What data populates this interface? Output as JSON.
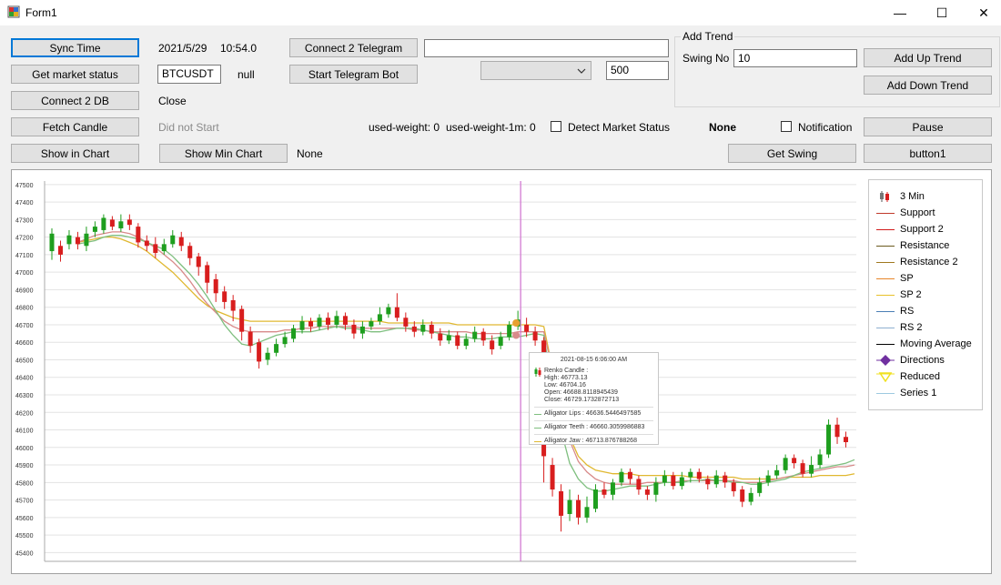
{
  "window": {
    "title": "Form1",
    "minimize": "—",
    "maximize": "☐",
    "close": "✕"
  },
  "left_buttons": {
    "sync_time": "Sync Time",
    "get_market_status": "Get market status",
    "connect_db": "Connect 2 DB",
    "fetch_candle": "Fetch Candle",
    "show_in_chart": "Show in Chart"
  },
  "info": {
    "date": "2021/5/29",
    "time": "10:54.0",
    "symbol": "BTCUSDT",
    "null_label": "null",
    "close_label": "Close",
    "did_not_start": "Did not Start",
    "show_min_chart": "Show Min Chart",
    "none_label": "None"
  },
  "telegram": {
    "connect": "Connect 2 Telegram",
    "start_bot": "Start Telegram Bot",
    "text_value": "",
    "combo_value": "",
    "number_value": "500"
  },
  "weights": {
    "used_weight": "used-weight: 0",
    "used_weight_1m": "used-weight-1m: 0"
  },
  "detect": {
    "label": "Detect Market Status",
    "status": "None",
    "notification": "Notification"
  },
  "trend": {
    "group_title": "Add Trend",
    "swing_label": "Swing No",
    "swing_value": "10",
    "add_up": "Add Up Trend",
    "add_down": "Add Down Trend"
  },
  "right_buttons": {
    "pause": "Pause",
    "get_swing": "Get Swing",
    "button1": "button1"
  },
  "tooltip": {
    "date": "2021-08-15 6:06:00 AM",
    "candle_title": "Renko Candle :",
    "high": "High: 46773.13",
    "low": "Low: 46704.16",
    "open": "Open: 46688.8118945439",
    "close": "Close: 46729.1732872713",
    "lips": "Alligator Lips : 46636.5446497585",
    "teeth": "Alligator Teeth : 46660.3059986883",
    "jaw": "Alligator Jaw : 46713.876788268"
  },
  "legend": [
    {
      "label": "3 Min",
      "type": "candle",
      "color": "#d81e1e"
    },
    {
      "label": "Support",
      "type": "line",
      "color": "#c0392b"
    },
    {
      "label": "Support 2",
      "type": "line",
      "color": "#d11a1a"
    },
    {
      "label": "Resistance",
      "type": "line",
      "color": "#6b5a1e"
    },
    {
      "label": "Resistance 2",
      "type": "line",
      "color": "#a0781e"
    },
    {
      "label": "SP",
      "type": "line",
      "color": "#e8862a"
    },
    {
      "label": "SP 2",
      "type": "line",
      "color": "#e8c02a"
    },
    {
      "label": "RS",
      "type": "line",
      "color": "#4a7fb5"
    },
    {
      "label": "RS 2",
      "type": "line",
      "color": "#8fb0d0"
    },
    {
      "label": "Moving Average",
      "type": "line",
      "color": "#000000"
    },
    {
      "label": "Directions",
      "type": "diamond",
      "color": "#7030a0"
    },
    {
      "label": "Reduced",
      "type": "triangle",
      "color": "#f0e020"
    },
    {
      "label": "Series 1",
      "type": "line",
      "color": "#9ec9e0"
    }
  ],
  "chart_data": {
    "type": "candlestick",
    "ylim": [
      45350,
      47520
    ],
    "y_ticks": [
      47500,
      47400,
      47300,
      47200,
      47100,
      47000,
      46900,
      46800,
      46700,
      46600,
      46500,
      46400,
      46300,
      46200,
      46100,
      46000,
      45900,
      45800,
      45700,
      45600,
      45500,
      45400
    ],
    "colors": {
      "up": "#1e9e1e",
      "down": "#d81e1e",
      "lips": "#7fbf7f",
      "teeth": "#d88a8a",
      "jaw": "#e0b830",
      "cursor": "#d070d0"
    },
    "candles": [
      {
        "o": 47120,
        "c": 47220,
        "h": 47250,
        "l": 47070
      },
      {
        "o": 47150,
        "c": 47100,
        "h": 47180,
        "l": 47060
      },
      {
        "o": 47160,
        "c": 47210,
        "h": 47240,
        "l": 47130
      },
      {
        "o": 47200,
        "c": 47160,
        "h": 47230,
        "l": 47130
      },
      {
        "o": 47150,
        "c": 47220,
        "h": 47260,
        "l": 47120
      },
      {
        "o": 47230,
        "c": 47260,
        "h": 47290,
        "l": 47200
      },
      {
        "o": 47240,
        "c": 47310,
        "h": 47330,
        "l": 47220
      },
      {
        "o": 47300,
        "c": 47260,
        "h": 47320,
        "l": 47240
      },
      {
        "o": 47250,
        "c": 47290,
        "h": 47330,
        "l": 47230
      },
      {
        "o": 47300,
        "c": 47270,
        "h": 47330,
        "l": 47240
      },
      {
        "o": 47260,
        "c": 47170,
        "h": 47280,
        "l": 47140
      },
      {
        "o": 47180,
        "c": 47150,
        "h": 47210,
        "l": 47120
      },
      {
        "o": 47160,
        "c": 47110,
        "h": 47200,
        "l": 47080
      },
      {
        "o": 47120,
        "c": 47160,
        "h": 47190,
        "l": 47100
      },
      {
        "o": 47160,
        "c": 47210,
        "h": 47240,
        "l": 47140
      },
      {
        "o": 47200,
        "c": 47150,
        "h": 47230,
        "l": 47120
      },
      {
        "o": 47150,
        "c": 47080,
        "h": 47170,
        "l": 47040
      },
      {
        "o": 47090,
        "c": 47030,
        "h": 47110,
        "l": 46980
      },
      {
        "o": 47040,
        "c": 46940,
        "h": 47060,
        "l": 46880
      },
      {
        "o": 46960,
        "c": 46880,
        "h": 46990,
        "l": 46830
      },
      {
        "o": 46890,
        "c": 46830,
        "h": 46920,
        "l": 46790
      },
      {
        "o": 46840,
        "c": 46780,
        "h": 46870,
        "l": 46720
      },
      {
        "o": 46790,
        "c": 46660,
        "h": 46810,
        "l": 46610
      },
      {
        "o": 46660,
        "c": 46580,
        "h": 46690,
        "l": 46540
      },
      {
        "o": 46600,
        "c": 46490,
        "h": 46620,
        "l": 46450
      },
      {
        "o": 46500,
        "c": 46540,
        "h": 46570,
        "l": 46470
      },
      {
        "o": 46540,
        "c": 46590,
        "h": 46620,
        "l": 46520
      },
      {
        "o": 46590,
        "c": 46630,
        "h": 46660,
        "l": 46570
      },
      {
        "o": 46620,
        "c": 46680,
        "h": 46700,
        "l": 46600
      },
      {
        "o": 46670,
        "c": 46720,
        "h": 46750,
        "l": 46650
      },
      {
        "o": 46720,
        "c": 46690,
        "h": 46740,
        "l": 46660
      },
      {
        "o": 46690,
        "c": 46740,
        "h": 46760,
        "l": 46670
      },
      {
        "o": 46740,
        "c": 46700,
        "h": 46770,
        "l": 46670
      },
      {
        "o": 46700,
        "c": 46750,
        "h": 46780,
        "l": 46680
      },
      {
        "o": 46750,
        "c": 46700,
        "h": 46770,
        "l": 46670
      },
      {
        "o": 46700,
        "c": 46650,
        "h": 46730,
        "l": 46620
      },
      {
        "o": 46650,
        "c": 46690,
        "h": 46720,
        "l": 46620
      },
      {
        "o": 46690,
        "c": 46720,
        "h": 46740,
        "l": 46670
      },
      {
        "o": 46720,
        "c": 46760,
        "h": 46800,
        "l": 46700
      },
      {
        "o": 46760,
        "c": 46800,
        "h": 46820,
        "l": 46740
      },
      {
        "o": 46800,
        "c": 46740,
        "h": 46880,
        "l": 46720
      },
      {
        "o": 46740,
        "c": 46690,
        "h": 46770,
        "l": 46660
      },
      {
        "o": 46690,
        "c": 46660,
        "h": 46720,
        "l": 46630
      },
      {
        "o": 46660,
        "c": 46700,
        "h": 46730,
        "l": 46640
      },
      {
        "o": 46700,
        "c": 46650,
        "h": 46720,
        "l": 46620
      },
      {
        "o": 46650,
        "c": 46610,
        "h": 46680,
        "l": 46580
      },
      {
        "o": 46610,
        "c": 46640,
        "h": 46670,
        "l": 46590
      },
      {
        "o": 46640,
        "c": 46580,
        "h": 46660,
        "l": 46560
      },
      {
        "o": 46580,
        "c": 46620,
        "h": 46650,
        "l": 46560
      },
      {
        "o": 46620,
        "c": 46660,
        "h": 46690,
        "l": 46600
      },
      {
        "o": 46660,
        "c": 46610,
        "h": 46680,
        "l": 46580
      },
      {
        "o": 46610,
        "c": 46560,
        "h": 46640,
        "l": 46530
      },
      {
        "o": 46580,
        "c": 46630,
        "h": 46660,
        "l": 46560
      },
      {
        "o": 46630,
        "c": 46700,
        "h": 46720,
        "l": 46610
      },
      {
        "o": 46690,
        "c": 46730,
        "h": 46780,
        "l": 46670
      },
      {
        "o": 46700,
        "c": 46660,
        "h": 46740,
        "l": 46630
      },
      {
        "o": 46660,
        "c": 46610,
        "h": 46690,
        "l": 46580
      },
      {
        "o": 46610,
        "c": 45950,
        "h": 46630,
        "l": 45800
      },
      {
        "o": 45900,
        "c": 45760,
        "h": 45940,
        "l": 45720
      },
      {
        "o": 45750,
        "c": 45610,
        "h": 45790,
        "l": 45520
      },
      {
        "o": 45620,
        "c": 45700,
        "h": 45760,
        "l": 45580
      },
      {
        "o": 45700,
        "c": 45600,
        "h": 45730,
        "l": 45560
      },
      {
        "o": 45600,
        "c": 45660,
        "h": 45720,
        "l": 45570
      },
      {
        "o": 45650,
        "c": 45760,
        "h": 45790,
        "l": 45630
      },
      {
        "o": 45760,
        "c": 45730,
        "h": 45800,
        "l": 45710
      },
      {
        "o": 45730,
        "c": 45800,
        "h": 45820,
        "l": 45700
      },
      {
        "o": 45800,
        "c": 45860,
        "h": 45880,
        "l": 45780
      },
      {
        "o": 45860,
        "c": 45820,
        "h": 45880,
        "l": 45790
      },
      {
        "o": 45820,
        "c": 45760,
        "h": 45840,
        "l": 45730
      },
      {
        "o": 45760,
        "c": 45730,
        "h": 45780,
        "l": 45700
      },
      {
        "o": 45730,
        "c": 45800,
        "h": 45830,
        "l": 45690
      },
      {
        "o": 45800,
        "c": 45840,
        "h": 45870,
        "l": 45780
      },
      {
        "o": 45840,
        "c": 45780,
        "h": 45860,
        "l": 45760
      },
      {
        "o": 45780,
        "c": 45830,
        "h": 45860,
        "l": 45760
      },
      {
        "o": 45830,
        "c": 45860,
        "h": 45880,
        "l": 45800
      },
      {
        "o": 45860,
        "c": 45820,
        "h": 45880,
        "l": 45800
      },
      {
        "o": 45820,
        "c": 45790,
        "h": 45840,
        "l": 45760
      },
      {
        "o": 45790,
        "c": 45840,
        "h": 45870,
        "l": 45770
      },
      {
        "o": 45840,
        "c": 45800,
        "h": 45860,
        "l": 45770
      },
      {
        "o": 45800,
        "c": 45750,
        "h": 45820,
        "l": 45720
      },
      {
        "o": 45760,
        "c": 45690,
        "h": 45780,
        "l": 45660
      },
      {
        "o": 45690,
        "c": 45740,
        "h": 45770,
        "l": 45670
      },
      {
        "o": 45740,
        "c": 45800,
        "h": 45830,
        "l": 45720
      },
      {
        "o": 45800,
        "c": 45840,
        "h": 45870,
        "l": 45780
      },
      {
        "o": 45840,
        "c": 45870,
        "h": 45900,
        "l": 45820
      },
      {
        "o": 45870,
        "c": 45940,
        "h": 45960,
        "l": 45850
      },
      {
        "o": 45940,
        "c": 45910,
        "h": 45960,
        "l": 45880
      },
      {
        "o": 45910,
        "c": 45850,
        "h": 45930,
        "l": 45830
      },
      {
        "o": 45850,
        "c": 45900,
        "h": 45950,
        "l": 45830
      },
      {
        "o": 45900,
        "c": 45960,
        "h": 45990,
        "l": 45880
      },
      {
        "o": 45960,
        "c": 46130,
        "h": 46160,
        "l": 45940
      },
      {
        "o": 46130,
        "c": 46060,
        "h": 46170,
        "l": 46020
      },
      {
        "o": 46060,
        "c": 46030,
        "h": 46090,
        "l": 46000
      }
    ],
    "lips": [
      47160,
      47170,
      47180,
      47200,
      47210,
      47210,
      47200,
      47190,
      47170,
      47150,
      47130,
      47090,
      47040,
      46990,
      46930,
      46860,
      46780,
      46700,
      46640,
      46590,
      46580,
      46600,
      46620,
      46640,
      46650,
      46660,
      46660,
      46660,
      46670,
      46680,
      46690,
      46680,
      46680,
      46670,
      46660,
      46660,
      46670,
      46680,
      46680,
      46680,
      46670,
      46660,
      46650,
      46640,
      46630,
      46630,
      46620,
      46620,
      46620,
      46630,
      46630,
      46630,
      46640,
      46650,
      46640,
      46330,
      46100,
      45910,
      45820,
      45770,
      45750,
      45750,
      45760,
      45770,
      45780,
      45780,
      45780,
      45790,
      45800,
      45800,
      45800,
      45810,
      45810,
      45820,
      45810,
      45810,
      45800,
      45800,
      45790,
      45790,
      45800,
      45810,
      45820,
      45840,
      45860,
      45870,
      45880,
      45890,
      45900,
      45910,
      45930
    ],
    "teeth": [
      47170,
      47190,
      47210,
      47220,
      47230,
      47230,
      47220,
      47200,
      47170,
      47140,
      47100,
      47060,
      47010,
      46950,
      46880,
      46820,
      46770,
      46720,
      46690,
      46670,
      46660,
      46660,
      46660,
      46660,
      46670,
      46670,
      46680,
      46680,
      46690,
      46690,
      46690,
      46690,
      46690,
      46680,
      46680,
      46680,
      46680,
      46680,
      46680,
      46670,
      46670,
      46660,
      46660,
      46660,
      46660,
      46660,
      46650,
      46650,
      46650,
      46650,
      46650,
      46660,
      46660,
      46660,
      46660,
      46440,
      46230,
      46040,
      45920,
      45860,
      45820,
      45800,
      45790,
      45790,
      45790,
      45790,
      45800,
      45800,
      45800,
      45800,
      45810,
      45810,
      45810,
      45810,
      45810,
      45810,
      45810,
      45800,
      45800,
      45800,
      45810,
      45820,
      45830,
      45840,
      45850,
      45860,
      45870,
      45880,
      45890,
      45890,
      45900
    ],
    "jaw": [
      47170,
      47180,
      47190,
      47200,
      47200,
      47190,
      47170,
      47150,
      47120,
      47080,
      47040,
      47000,
      46950,
      46900,
      46850,
      46810,
      46780,
      46760,
      46740,
      46730,
      46720,
      46720,
      46720,
      46720,
      46720,
      46720,
      46720,
      46720,
      46720,
      46720,
      46720,
      46720,
      46720,
      46720,
      46720,
      46720,
      46710,
      46710,
      46710,
      46710,
      46710,
      46710,
      46710,
      46710,
      46700,
      46700,
      46700,
      46700,
      46700,
      46700,
      46700,
      46700,
      46700,
      46700,
      46690,
      46450,
      46240,
      46060,
      45950,
      45900,
      45870,
      45860,
      45850,
      45850,
      45850,
      45840,
      45840,
      45840,
      45840,
      45840,
      45840,
      45830,
      45830,
      45830,
      45830,
      45830,
      45830,
      45820,
      45820,
      45820,
      45820,
      45820,
      45830,
      45830,
      45830,
      45830,
      45840,
      45840,
      45840,
      45840,
      45850
    ]
  }
}
